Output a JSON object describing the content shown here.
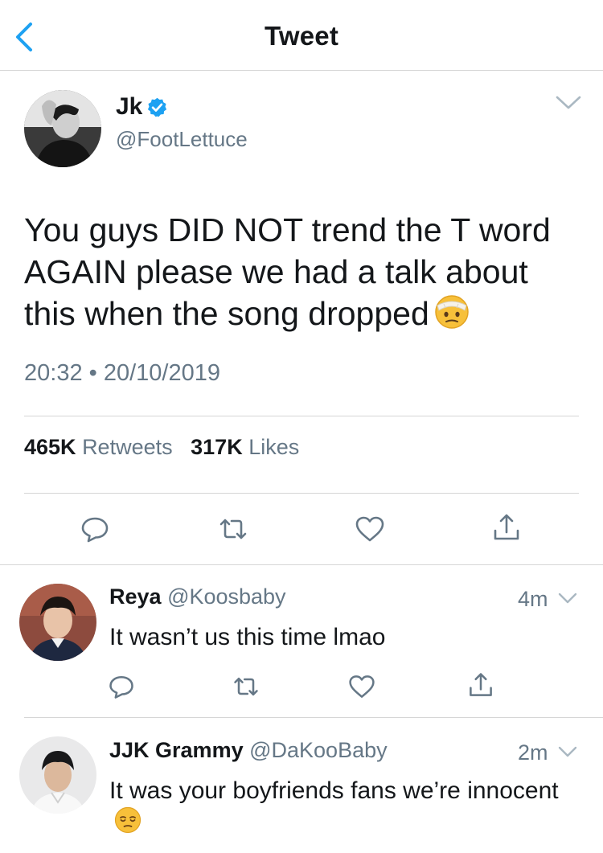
{
  "header": {
    "title": "Tweet"
  },
  "tweet": {
    "display_name": "Jk",
    "handle": "@FootLettuce",
    "text": "You guys DID NOT trend the T word AGAIN please we had a talk about this when the song dropped",
    "timestamp": "20:32 • 20/10/2019",
    "retweets_count": "465K",
    "retweets_label": "Retweets",
    "likes_count": "317K",
    "likes_label": "Likes"
  },
  "replies": [
    {
      "display_name": "Reya",
      "handle": "@Koosbaby",
      "time": "4m",
      "text": "It wasn’t us this time lmao"
    },
    {
      "display_name": "JJK Grammy",
      "handle": "@DaKooBaby",
      "time": "2m",
      "text": "It was your boyfriends fans we’re innocent"
    }
  ],
  "colors": {
    "accent": "#1da1f2",
    "secondary_text": "#657786",
    "divider": "#d6d6d6"
  },
  "icons": [
    "back-chevron-icon",
    "verified-badge-icon",
    "chevron-down-icon",
    "reply-icon",
    "retweet-icon",
    "like-icon",
    "share-icon",
    "bandaged-face-emoji",
    "pensive-face-emoji"
  ]
}
